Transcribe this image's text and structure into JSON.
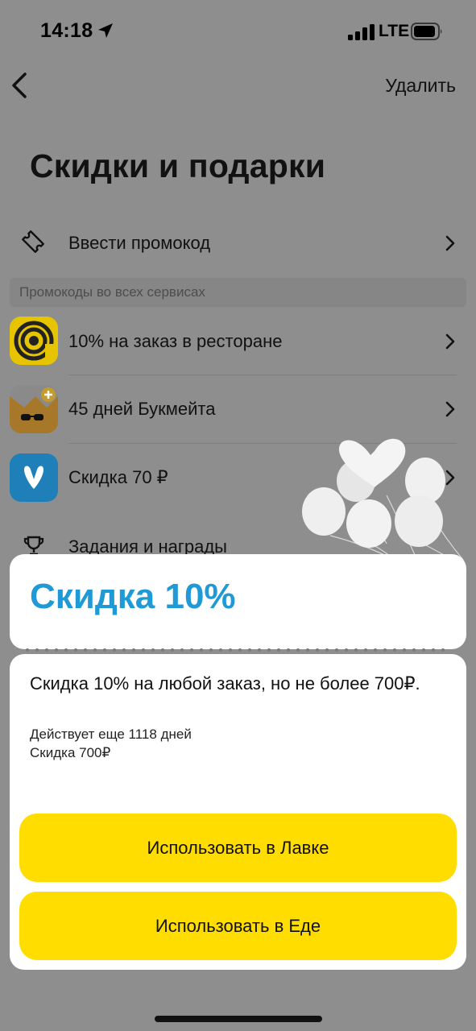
{
  "status_bar": {
    "time": "14:18",
    "network": "LTE"
  },
  "nav": {
    "delete_label": "Удалить"
  },
  "page": {
    "title": "Скидки и подарки"
  },
  "promo_entry": {
    "label": "Ввести промокод"
  },
  "section": {
    "header": "Промокоды во всех сервисах"
  },
  "items": [
    {
      "label": "10% на заказ в ресторане",
      "icon": "restaurant-spiral-icon"
    },
    {
      "label": "45 дней Букмейта",
      "icon": "bookmate-icon"
    },
    {
      "label": "Скидка 70 ₽",
      "icon": "service-v-icon"
    },
    {
      "label": "Задания и награды",
      "icon": "trophy-icon"
    }
  ],
  "sheet": {
    "title": "Скидка 10%",
    "description": "Скидка 10% на любой заказ, но не более 700₽.",
    "valid_text": "Действует еще 1118 дней",
    "discount_text": "Скидка 700₽",
    "button_lavka": "Использовать в Лавке",
    "button_eda": "Использовать в Еде"
  },
  "colors": {
    "accent_blue": "#1f9ad7",
    "button_yellow": "#ffdd00"
  }
}
